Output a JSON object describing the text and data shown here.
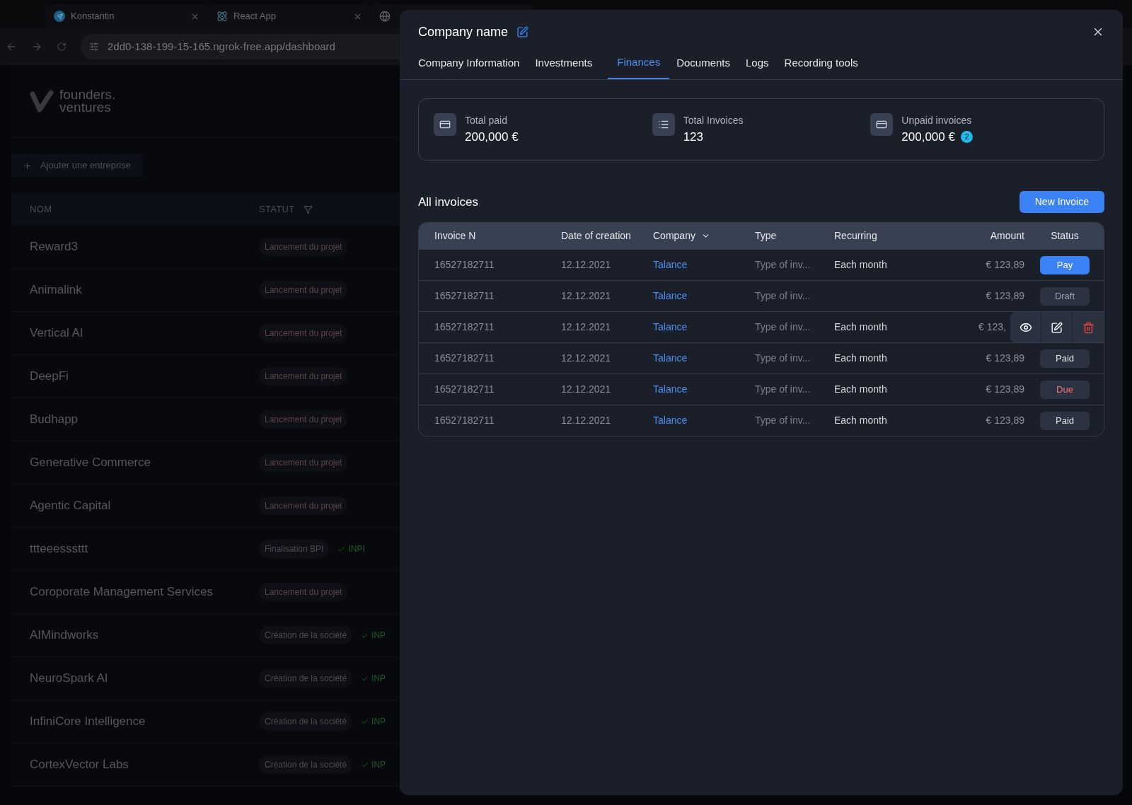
{
  "browser": {
    "tabs": [
      {
        "label": "Konstantin",
        "kind": "telegram"
      },
      {
        "label": "React App",
        "kind": "react"
      },
      {
        "kind": "globe"
      }
    ],
    "address": "2dd0-138-199-15-165.ngrok-free.app/dashboard"
  },
  "dashboard": {
    "logo": [
      "founders.",
      "ventures"
    ],
    "add_button": "Ajouter une entreprise",
    "columns": [
      "NOM",
      "STATUT"
    ],
    "rows": [
      {
        "name": "Reward3",
        "status": "Lancement du projet",
        "kind": "launch"
      },
      {
        "name": "Animalink",
        "status": "Lancement du projet",
        "kind": "launch"
      },
      {
        "name": "Vertical AI",
        "status": "Lancement du projet",
        "kind": "launch"
      },
      {
        "name": "DeepFi",
        "status": "Lancement du projet",
        "kind": "launch"
      },
      {
        "name": "Budhapp",
        "status": "Lancement du projet",
        "kind": "launch"
      },
      {
        "name": "Generative Commerce",
        "status": "Lancement du projet",
        "kind": "launch"
      },
      {
        "name": "Agentic Capital",
        "status": "Lancement du projet",
        "kind": "launch"
      },
      {
        "name": "ttteeesssttt",
        "status": "Finalisation BPI",
        "kind": "other",
        "check": "INPI"
      },
      {
        "name": "Coroporate Management Services",
        "status": "Lancement du projet",
        "kind": "launch"
      },
      {
        "name": "AIMindworks",
        "status": "Création de la société",
        "kind": "other",
        "check": "INP"
      },
      {
        "name": "NeuroSpark AI",
        "status": "Création de la société",
        "kind": "other",
        "check": "INP"
      },
      {
        "name": "InfiniCore Intelligence",
        "status": "Création de la société",
        "kind": "other",
        "check": "INP"
      },
      {
        "name": "CortexVector Labs",
        "status": "Création de la société",
        "kind": "other",
        "check": "INP"
      }
    ]
  },
  "modal": {
    "title": "Company name",
    "tabs": [
      {
        "label": "Company Information",
        "selected": false
      },
      {
        "label": "Investments",
        "selected": false
      },
      {
        "label": "Finances",
        "selected": true
      },
      {
        "label": "Documents",
        "selected": false
      },
      {
        "label": "Logs",
        "selected": false
      },
      {
        "label": "Recording tools",
        "selected": false
      }
    ],
    "stats": [
      {
        "label": "Total paid",
        "value": "200,000 €",
        "kind": "card-check"
      },
      {
        "label": "Total Invoices",
        "value": "123",
        "kind": "list"
      },
      {
        "label": "Unpaid invoices",
        "value": "200,000 €",
        "kind": "card-plus",
        "badge": "2"
      }
    ],
    "section_title": "All invoices",
    "new_button": "New Invoice",
    "columns": [
      "Invoice N",
      "Date of creation",
      "Company",
      "Type",
      "Recurring",
      "Amount",
      "Status"
    ],
    "rows": [
      {
        "number": "16527182711",
        "date": "12.12.2021",
        "company": "Talance",
        "type": "Type of inv...",
        "recurring": "Each month",
        "amount": "€ 123,89",
        "status": "Pay",
        "kind": "pay",
        "hovered": false
      },
      {
        "number": "16527182711",
        "date": "12.12.2021",
        "company": "Talance",
        "type": "Type of inv...",
        "amount": "€ 123,89",
        "status": "Draft",
        "kind": "draft",
        "hovered": false
      },
      {
        "number": "16527182711",
        "date": "12.12.2021",
        "company": "Talance",
        "type": "Type of inv...",
        "recurring": "Each month",
        "amount": "€ 123,",
        "hovered": true
      },
      {
        "number": "16527182711",
        "date": "12.12.2021",
        "company": "Talance",
        "type": "Type of inv...",
        "recurring": "Each month",
        "amount": "€ 123,89",
        "status": "Paid",
        "kind": "paid",
        "hovered": false
      },
      {
        "number": "16527182711",
        "date": "12.12.2021",
        "company": "Talance",
        "type": "Type of inv...",
        "recurring": "Each month",
        "amount": "€ 123,89",
        "status": "Due",
        "kind": "due",
        "hovered": false
      },
      {
        "number": "16527182711",
        "date": "12.12.2021",
        "company": "Talance",
        "type": "Type of inv...",
        "recurring": "Each month",
        "amount": "€ 123,89",
        "status": "Paid",
        "kind": "paid",
        "hovered": false
      }
    ]
  }
}
